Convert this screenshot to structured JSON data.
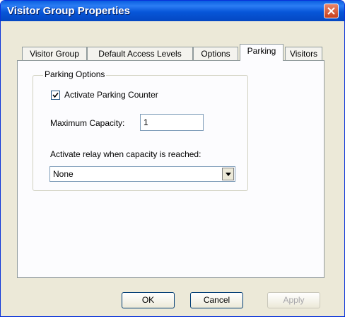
{
  "window": {
    "title": "Visitor Group Properties"
  },
  "tabs": [
    {
      "label": "Visitor Group"
    },
    {
      "label": "Default Access Levels"
    },
    {
      "label": "Options"
    },
    {
      "label": "Parking"
    },
    {
      "label": "Visitors"
    }
  ],
  "active_tab": "Parking",
  "parking": {
    "group_label": "Parking Options",
    "activate_counter_label": "Activate Parking Counter",
    "activate_counter_checked": true,
    "max_capacity_label": "Maximum Capacity:",
    "max_capacity_value": "1",
    "relay_label": "Activate relay when capacity is reached:",
    "relay_selected": "None"
  },
  "buttons": {
    "ok": "OK",
    "cancel": "Cancel",
    "apply": "Apply"
  }
}
